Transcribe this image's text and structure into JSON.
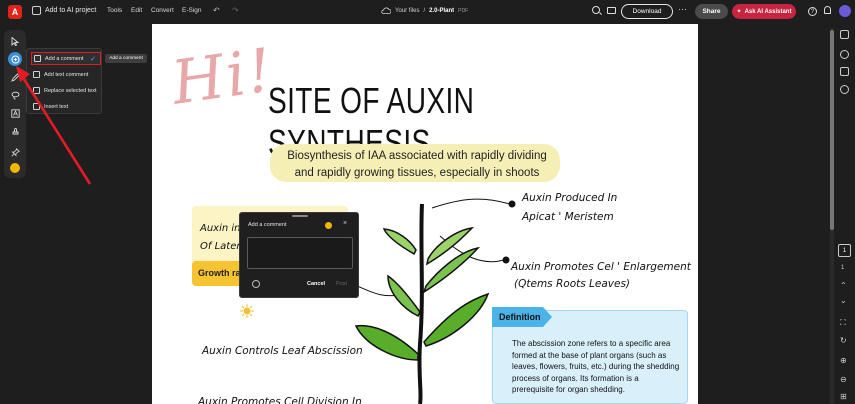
{
  "topbar": {
    "ai_project": "Add to AI project",
    "menus": [
      "Tools",
      "Edit",
      "Convert",
      "E-Sign"
    ],
    "breadcrumb_root": "Your files",
    "separator": "/",
    "file_name": "2.0-Plant",
    "file_type": "PDF",
    "download": "Download",
    "share": "Share",
    "ai_assistant": "Ask AI Assistant",
    "help": "?"
  },
  "comment_menu": {
    "items": [
      {
        "label": "Add a comment",
        "icon": "comment-icon"
      },
      {
        "label": "Add text comment",
        "icon": "text-comment-icon"
      },
      {
        "label": "Replace selected text",
        "icon": "replace-text-icon"
      },
      {
        "label": "Insert text",
        "icon": "insert-text-icon"
      }
    ],
    "tooltip": "Add a comment",
    "check": "✓"
  },
  "page": {
    "hi": "Hi!",
    "title": "SITE OF AUXIN SYNTHESIS",
    "subtitle": "Biosynthesis of IAA associated with rapidly dividing and rapidly growing tissues, especially in shoots",
    "label_produced_1": "Auxin Produced In",
    "label_produced_2": "Apicat ' Meristem",
    "label_enlarge_1": "Auxin Promotes Cel ' Enlargement",
    "label_enlarge_2": "(Qtems Roots Leaves)",
    "card_line1": "Auxin in",
    "card_line2": "Of Later",
    "card_band": "Growth ra",
    "label_leaf": "Auxin Controls Leaf Abscission",
    "label_division": "Auxin Promotes Cell Division In",
    "definition_tag": "Definition",
    "definition_body": "The abscission zone refers to a specific area formed at the base of plant organs (such as leaves, flowers, fruits, etc.) during the shedding process of organs. Its formation is a prerequisite for organ shedding."
  },
  "comment_popup": {
    "title": "Add a comment",
    "close": "×",
    "cancel": "Cancel",
    "post": "Post"
  },
  "pager": {
    "current": "1",
    "total": "1"
  },
  "colors": {
    "accent_red": "#c9243f",
    "highlight_red": "#e31b23",
    "active_blue": "#3b8fd9",
    "comment_yellow": "#f2b705"
  }
}
